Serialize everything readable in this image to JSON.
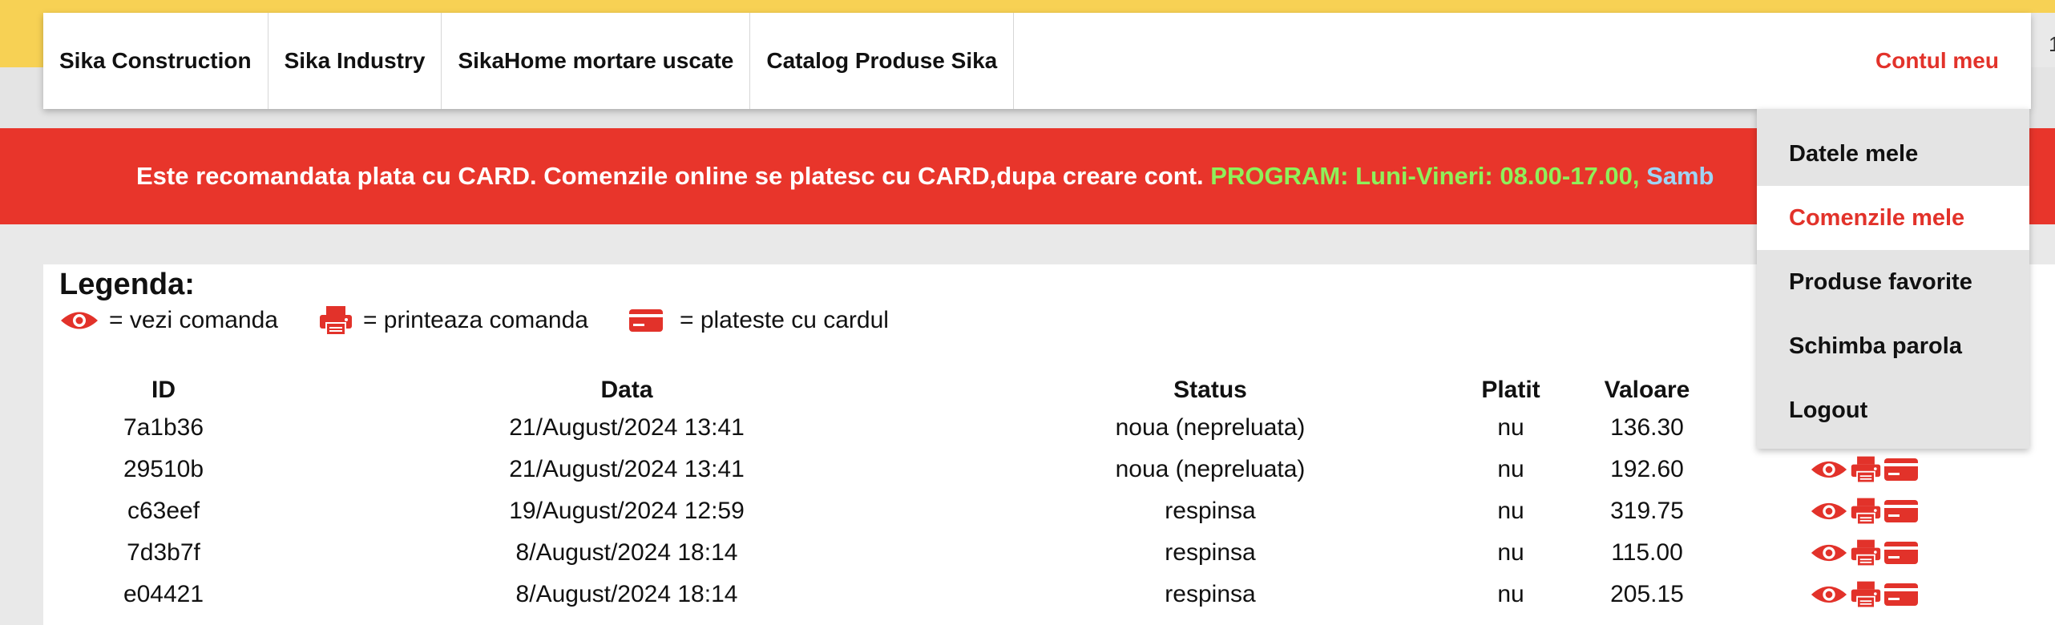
{
  "nav": {
    "items": [
      {
        "label": "Sika Construction"
      },
      {
        "label": "Sika Industry"
      },
      {
        "label": "SikaHome mortare uscate"
      },
      {
        "label": "Catalog Produse Sika"
      }
    ],
    "account_label": "Contul meu",
    "edge_char": "1"
  },
  "banner": {
    "text": "Este recomandata plata cu CARD. Comenzile online se platesc cu CARD,dupa creare cont. ",
    "program": "PROGRAM: Luni-Vineri: 08.00-17.00, ",
    "saturday": "Samb"
  },
  "legend": {
    "title": "Legenda:",
    "view": "= vezi comanda",
    "print": "= printeaza comanda",
    "pay": "= plateste cu cardul"
  },
  "table": {
    "headers": {
      "id": "ID",
      "date": "Data",
      "status": "Status",
      "paid": "Platit",
      "value": "Valoare"
    },
    "rows": [
      {
        "id": "7a1b36",
        "date": "21/August/2024 13:41",
        "status": "noua (nepreluata)",
        "paid": "nu",
        "value": "136.30"
      },
      {
        "id": "29510b",
        "date": "21/August/2024 13:41",
        "status": "noua (nepreluata)",
        "paid": "nu",
        "value": "192.60"
      },
      {
        "id": "c63eef",
        "date": "19/August/2024 12:59",
        "status": "respinsa",
        "paid": "nu",
        "value": "319.75"
      },
      {
        "id": "7d3b7f",
        "date": "8/August/2024 18:14",
        "status": "respinsa",
        "paid": "nu",
        "value": "115.00"
      },
      {
        "id": "e04421",
        "date": "8/August/2024 18:14",
        "status": "respinsa",
        "paid": "nu",
        "value": "205.15"
      }
    ]
  },
  "dropdown": {
    "items": [
      {
        "label": "Datele mele"
      },
      {
        "label": "Comenzile mele"
      },
      {
        "label": "Produse favorite"
      },
      {
        "label": "Schimba parola"
      },
      {
        "label": "Logout"
      }
    ],
    "active": "Comenzile mele"
  },
  "icons": {
    "view": "eye-icon",
    "print": "printer-icon",
    "pay": "credit-card-icon"
  },
  "colors": {
    "brand_yellow": "#f7d154",
    "brand_red": "#e8352b",
    "accent_red": "#e2322a",
    "program_green": "#8ff05a",
    "saturday_blue": "#9fd4f5"
  }
}
